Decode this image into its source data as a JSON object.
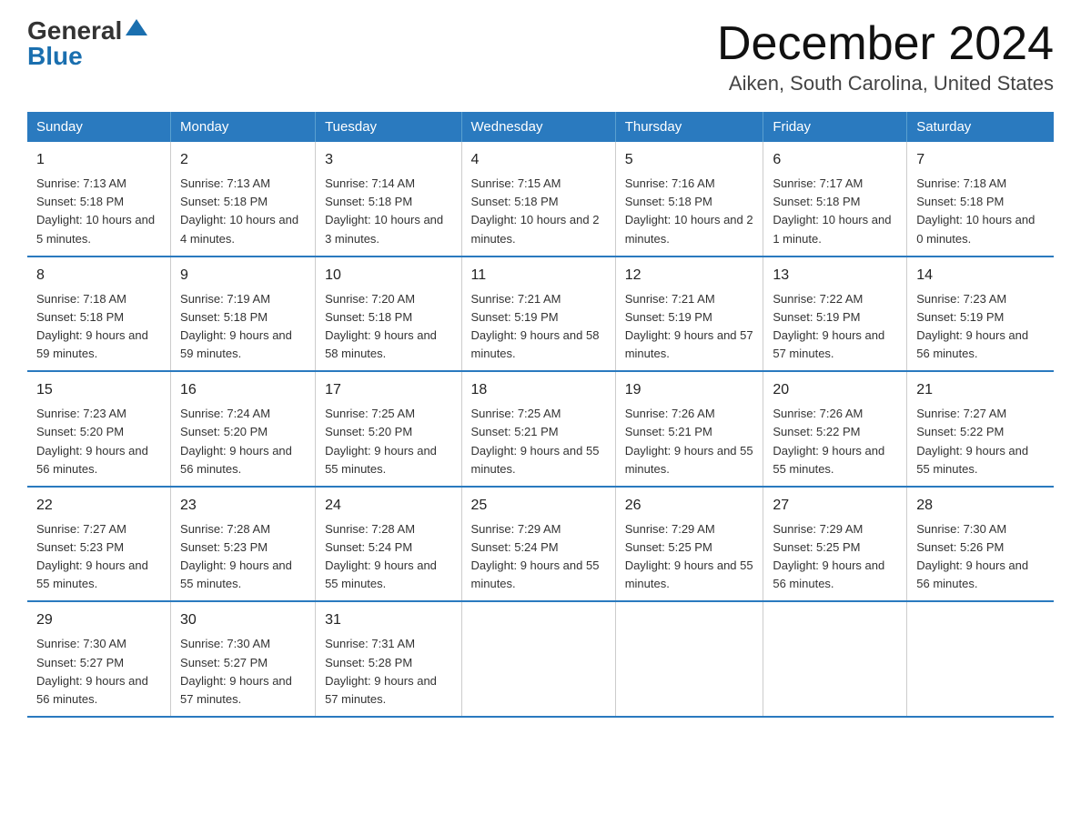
{
  "logo": {
    "general": "General",
    "blue": "Blue"
  },
  "title": "December 2024",
  "subtitle": "Aiken, South Carolina, United States",
  "days_of_week": [
    "Sunday",
    "Monday",
    "Tuesday",
    "Wednesday",
    "Thursday",
    "Friday",
    "Saturday"
  ],
  "weeks": [
    [
      {
        "day": "1",
        "sunrise": "7:13 AM",
        "sunset": "5:18 PM",
        "daylight": "10 hours and 5 minutes."
      },
      {
        "day": "2",
        "sunrise": "7:13 AM",
        "sunset": "5:18 PM",
        "daylight": "10 hours and 4 minutes."
      },
      {
        "day": "3",
        "sunrise": "7:14 AM",
        "sunset": "5:18 PM",
        "daylight": "10 hours and 3 minutes."
      },
      {
        "day": "4",
        "sunrise": "7:15 AM",
        "sunset": "5:18 PM",
        "daylight": "10 hours and 2 minutes."
      },
      {
        "day": "5",
        "sunrise": "7:16 AM",
        "sunset": "5:18 PM",
        "daylight": "10 hours and 2 minutes."
      },
      {
        "day": "6",
        "sunrise": "7:17 AM",
        "sunset": "5:18 PM",
        "daylight": "10 hours and 1 minute."
      },
      {
        "day": "7",
        "sunrise": "7:18 AM",
        "sunset": "5:18 PM",
        "daylight": "10 hours and 0 minutes."
      }
    ],
    [
      {
        "day": "8",
        "sunrise": "7:18 AM",
        "sunset": "5:18 PM",
        "daylight": "9 hours and 59 minutes."
      },
      {
        "day": "9",
        "sunrise": "7:19 AM",
        "sunset": "5:18 PM",
        "daylight": "9 hours and 59 minutes."
      },
      {
        "day": "10",
        "sunrise": "7:20 AM",
        "sunset": "5:18 PM",
        "daylight": "9 hours and 58 minutes."
      },
      {
        "day": "11",
        "sunrise": "7:21 AM",
        "sunset": "5:19 PM",
        "daylight": "9 hours and 58 minutes."
      },
      {
        "day": "12",
        "sunrise": "7:21 AM",
        "sunset": "5:19 PM",
        "daylight": "9 hours and 57 minutes."
      },
      {
        "day": "13",
        "sunrise": "7:22 AM",
        "sunset": "5:19 PM",
        "daylight": "9 hours and 57 minutes."
      },
      {
        "day": "14",
        "sunrise": "7:23 AM",
        "sunset": "5:19 PM",
        "daylight": "9 hours and 56 minutes."
      }
    ],
    [
      {
        "day": "15",
        "sunrise": "7:23 AM",
        "sunset": "5:20 PM",
        "daylight": "9 hours and 56 minutes."
      },
      {
        "day": "16",
        "sunrise": "7:24 AM",
        "sunset": "5:20 PM",
        "daylight": "9 hours and 56 minutes."
      },
      {
        "day": "17",
        "sunrise": "7:25 AM",
        "sunset": "5:20 PM",
        "daylight": "9 hours and 55 minutes."
      },
      {
        "day": "18",
        "sunrise": "7:25 AM",
        "sunset": "5:21 PM",
        "daylight": "9 hours and 55 minutes."
      },
      {
        "day": "19",
        "sunrise": "7:26 AM",
        "sunset": "5:21 PM",
        "daylight": "9 hours and 55 minutes."
      },
      {
        "day": "20",
        "sunrise": "7:26 AM",
        "sunset": "5:22 PM",
        "daylight": "9 hours and 55 minutes."
      },
      {
        "day": "21",
        "sunrise": "7:27 AM",
        "sunset": "5:22 PM",
        "daylight": "9 hours and 55 minutes."
      }
    ],
    [
      {
        "day": "22",
        "sunrise": "7:27 AM",
        "sunset": "5:23 PM",
        "daylight": "9 hours and 55 minutes."
      },
      {
        "day": "23",
        "sunrise": "7:28 AM",
        "sunset": "5:23 PM",
        "daylight": "9 hours and 55 minutes."
      },
      {
        "day": "24",
        "sunrise": "7:28 AM",
        "sunset": "5:24 PM",
        "daylight": "9 hours and 55 minutes."
      },
      {
        "day": "25",
        "sunrise": "7:29 AM",
        "sunset": "5:24 PM",
        "daylight": "9 hours and 55 minutes."
      },
      {
        "day": "26",
        "sunrise": "7:29 AM",
        "sunset": "5:25 PM",
        "daylight": "9 hours and 55 minutes."
      },
      {
        "day": "27",
        "sunrise": "7:29 AM",
        "sunset": "5:25 PM",
        "daylight": "9 hours and 56 minutes."
      },
      {
        "day": "28",
        "sunrise": "7:30 AM",
        "sunset": "5:26 PM",
        "daylight": "9 hours and 56 minutes."
      }
    ],
    [
      {
        "day": "29",
        "sunrise": "7:30 AM",
        "sunset": "5:27 PM",
        "daylight": "9 hours and 56 minutes."
      },
      {
        "day": "30",
        "sunrise": "7:30 AM",
        "sunset": "5:27 PM",
        "daylight": "9 hours and 57 minutes."
      },
      {
        "day": "31",
        "sunrise": "7:31 AM",
        "sunset": "5:28 PM",
        "daylight": "9 hours and 57 minutes."
      },
      null,
      null,
      null,
      null
    ]
  ]
}
